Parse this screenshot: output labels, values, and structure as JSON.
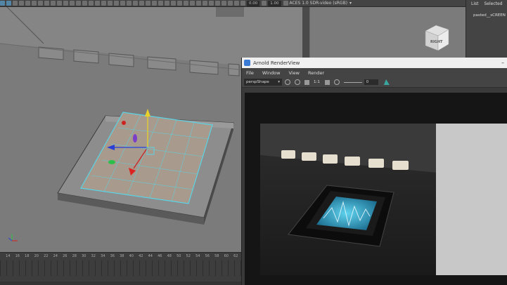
{
  "toolbar": {
    "value_a": "0.00",
    "value_b": "1.00",
    "color_space": "ACES 1.0 SDR-video (sRGB)"
  },
  "viewport": {
    "cube_face": "RIGHT"
  },
  "channel_box": {
    "tabs": [
      "List",
      "Selected"
    ],
    "item": "pasted__sCREEN"
  },
  "timeline": {
    "ticks": [
      "14",
      "16",
      "18",
      "20",
      "22",
      "24",
      "26",
      "28",
      "30",
      "32",
      "34",
      "36",
      "38",
      "40",
      "42",
      "44",
      "46",
      "48",
      "50",
      "52",
      "54",
      "56",
      "58",
      "60",
      "62"
    ]
  },
  "render_view": {
    "title": "Arnold RenderView",
    "menu": [
      "File",
      "Window",
      "View",
      "Render"
    ],
    "camera": "perspShape",
    "ratio": "1:1",
    "exposure": "0"
  },
  "colors": {
    "viewport_bg": "#7a7a7a",
    "ui_dark": "#444444",
    "selection_cyan": "#5ad4e6",
    "screen_glow": "#3bb3d9"
  }
}
